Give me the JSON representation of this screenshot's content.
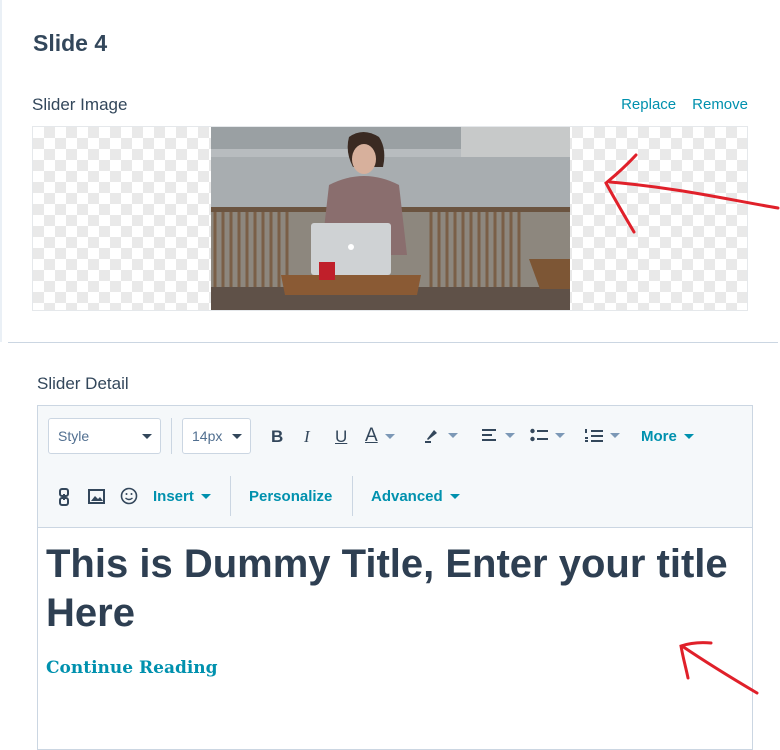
{
  "slide": {
    "title": "Slide 4",
    "image_label": "Slider Image",
    "replace_label": "Replace",
    "remove_label": "Remove",
    "detail_label": "Slider Detail"
  },
  "toolbar": {
    "style_select": "Style",
    "size_select": "14px",
    "bold": "B",
    "italic": "I",
    "underline": "U",
    "text_color": "A",
    "more": "More",
    "insert": "Insert",
    "personalize": "Personalize",
    "advanced": "Advanced",
    "icons": [
      "highlighter-icon",
      "align-left-icon",
      "bulleted-list-icon",
      "numbered-list-icon",
      "link-icon",
      "image-icon",
      "emoji-icon"
    ]
  },
  "content": {
    "title": "This is Dummy Title, Enter your title Here",
    "continue": "Continue Reading"
  },
  "colors": {
    "accent": "#0091ae",
    "text": "#33475b",
    "annotation": "#e0202a"
  }
}
